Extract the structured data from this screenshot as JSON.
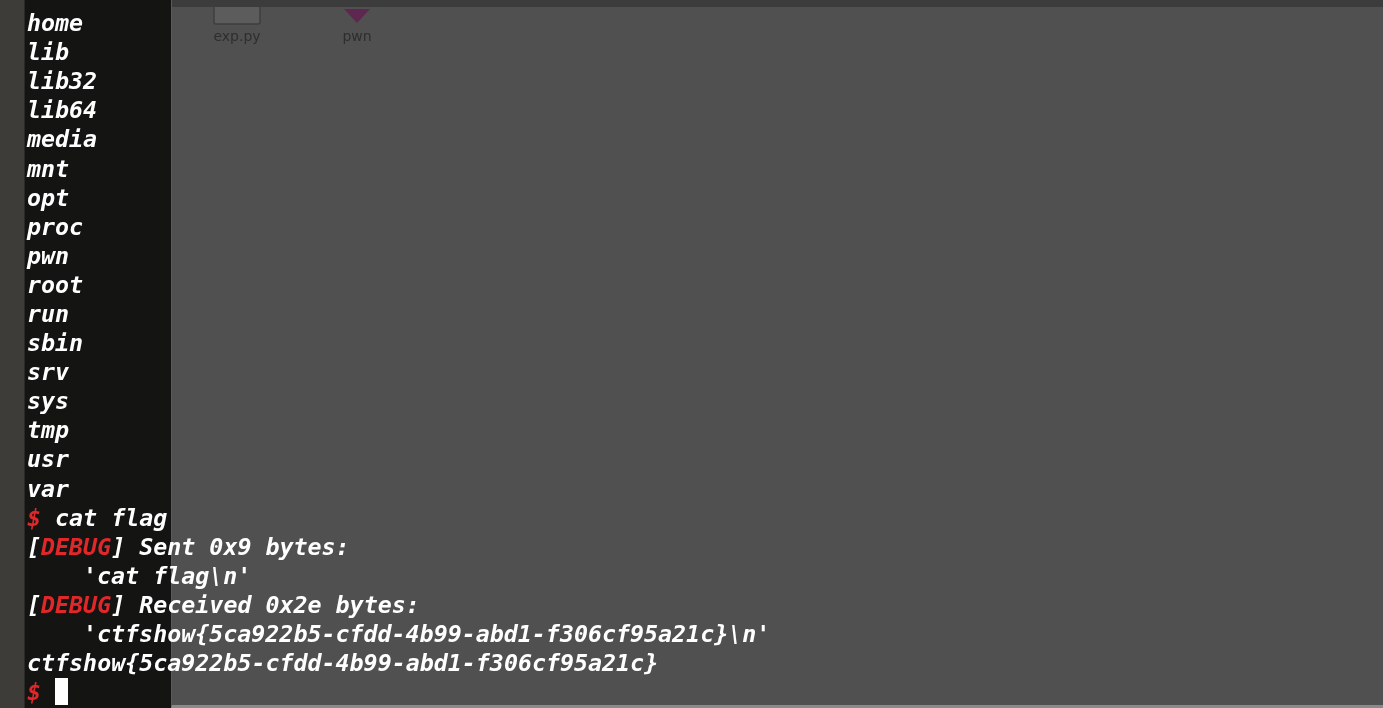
{
  "files": [
    {
      "name": "exp.py",
      "kind": "script"
    },
    {
      "name": "pwn",
      "kind": "executable"
    }
  ],
  "terminal": {
    "lines": [
      {
        "kind": "output",
        "text": "home"
      },
      {
        "kind": "output",
        "text": "lib"
      },
      {
        "kind": "output",
        "text": "lib32"
      },
      {
        "kind": "output",
        "text": "lib64"
      },
      {
        "kind": "output",
        "text": "media"
      },
      {
        "kind": "output",
        "text": "mnt"
      },
      {
        "kind": "output",
        "text": "opt"
      },
      {
        "kind": "output",
        "text": "proc"
      },
      {
        "kind": "output",
        "text": "pwn"
      },
      {
        "kind": "output",
        "text": "root"
      },
      {
        "kind": "output",
        "text": "run"
      },
      {
        "kind": "output",
        "text": "sbin"
      },
      {
        "kind": "output",
        "text": "srv"
      },
      {
        "kind": "output",
        "text": "sys"
      },
      {
        "kind": "output",
        "text": "tmp"
      },
      {
        "kind": "output",
        "text": "usr"
      },
      {
        "kind": "output",
        "text": "var"
      },
      {
        "kind": "prompt",
        "prompt": "$",
        "text": " cat flag"
      },
      {
        "kind": "debug",
        "before": "[",
        "tag": "DEBUG",
        "after": "] Sent 0x9 bytes:"
      },
      {
        "kind": "indented",
        "text": "'cat flag\\n'"
      },
      {
        "kind": "debug",
        "before": "[",
        "tag": "DEBUG",
        "after": "] Received 0x2e bytes:"
      },
      {
        "kind": "indented",
        "text": "'ctfshow{5ca922b5-cfdd-4b99-abd1-f306cf95a21c}\\n'"
      },
      {
        "kind": "output",
        "text": "ctfshow{5ca922b5-cfdd-4b99-abd1-f306cf95a21c}"
      },
      {
        "kind": "cursor",
        "prompt": "$",
        "cursor": true
      }
    ]
  }
}
